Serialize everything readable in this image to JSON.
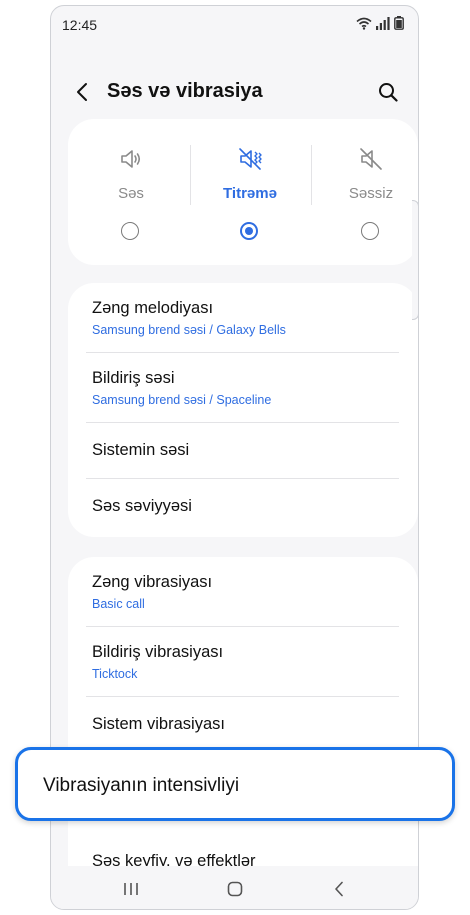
{
  "status_bar": {
    "time": "12:45"
  },
  "header": {
    "title": "Səs və vibrasiya"
  },
  "sound_modes": [
    {
      "label": "Səs",
      "icon": "speaker-icon",
      "selected": false
    },
    {
      "label": "Titrəmə",
      "icon": "vibrate-icon",
      "selected": true
    },
    {
      "label": "Səssiz",
      "icon": "mute-icon",
      "selected": false
    }
  ],
  "sound_group": {
    "items": [
      {
        "title": "Zəng melodiyası",
        "subtitle": "Samsung brend səsi / Galaxy Bells"
      },
      {
        "title": "Bildiriş səsi",
        "subtitle": "Samsung brend səsi / Spaceline"
      },
      {
        "title": "Sistemin səsi"
      },
      {
        "title": "Səs səviyyəsi"
      }
    ]
  },
  "vibration_group": {
    "items": [
      {
        "title": "Zəng vibrasiyası",
        "subtitle": "Basic call"
      },
      {
        "title": "Bildiriş vibrasiyası",
        "subtitle": "Ticktock"
      },
      {
        "title": "Sistem vibrasiyası"
      }
    ]
  },
  "highlighted_item": {
    "title": "Vibrasiyanın intensivliyi"
  },
  "next_item": {
    "title": "Səs keyfiy. və effektlər"
  },
  "colors": {
    "accent": "#2f6de1",
    "highlight_border": "#1a73e8",
    "background": "#f6f6f8"
  }
}
